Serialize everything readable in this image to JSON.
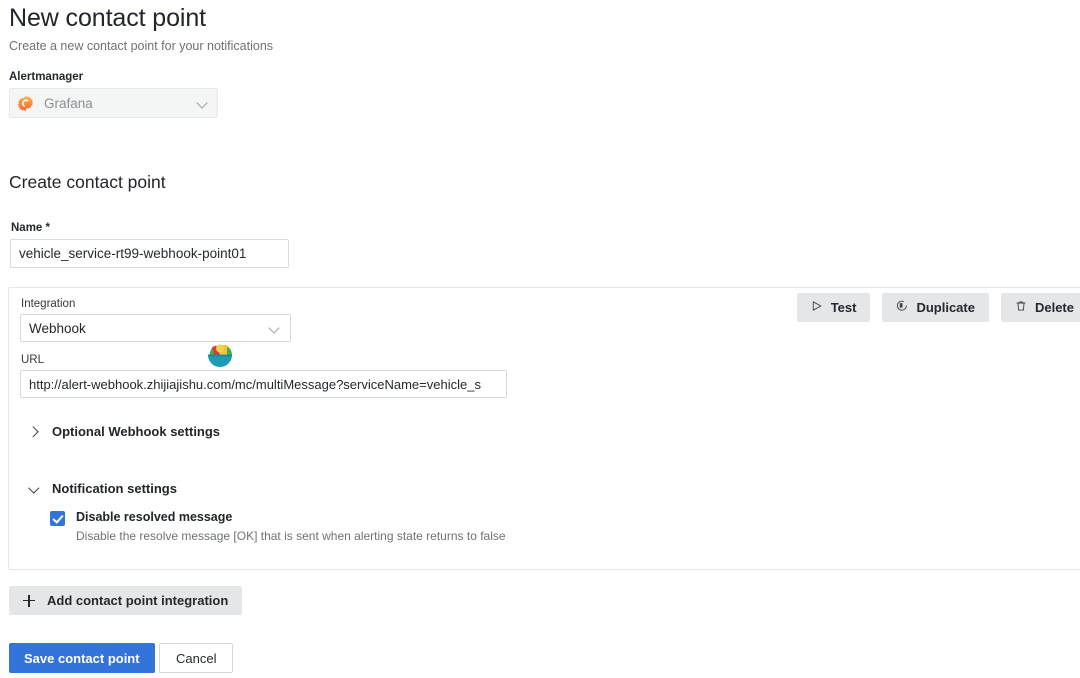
{
  "header": {
    "title": "New contact point",
    "subtitle": "Create a new contact point for your notifications"
  },
  "alertmanager": {
    "label": "Alertmanager",
    "selected": "Grafana",
    "logo_colors": [
      "#f05a28",
      "#fbb03b"
    ]
  },
  "form": {
    "section_title": "Create contact point",
    "name_label": "Name *",
    "name_value": "vehicle_service-rt99-webhook-point01"
  },
  "integration": {
    "label": "Integration",
    "selected": "Webhook",
    "url_label": "URL",
    "url_value": "http://alert-webhook.zhijiajishu.com/mc/multiMessage?serviceName=vehicle_s",
    "actions": [
      {
        "label": "Test",
        "icon": "play-icon"
      },
      {
        "label": "Duplicate",
        "icon": "copy-icon"
      },
      {
        "label": "Delete",
        "icon": "trash-icon"
      }
    ],
    "optional_settings_label": "Optional Webhook settings",
    "notification_settings_label": "Notification settings",
    "disable_resolved_title": "Disable resolved message",
    "disable_resolved_desc": "Disable the resolve message [OK] that is sent when alerting state returns to false",
    "disable_resolved_checked": true
  },
  "footer": {
    "add_integration_label": "Add contact point integration",
    "save_label": "Save contact point",
    "cancel_label": "Cancel",
    "accent_color": "#3274d9"
  }
}
